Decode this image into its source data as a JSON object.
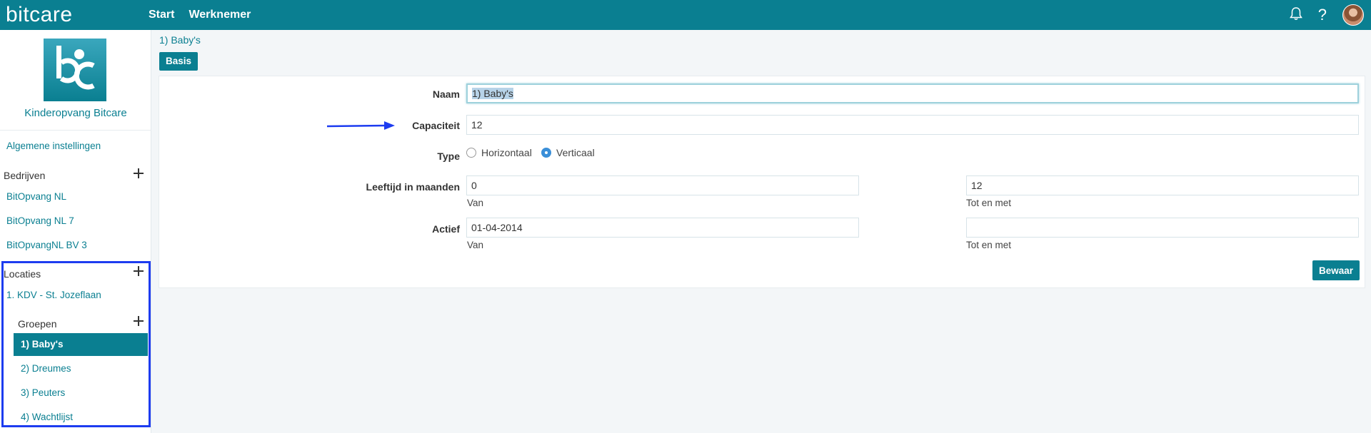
{
  "app": {
    "brand": "bitcare",
    "nav": [
      "Start",
      "Werknemer"
    ],
    "icons": [
      "bell-icon",
      "help-icon",
      "avatar"
    ]
  },
  "sidebar": {
    "org_name": "Kinderopvang Bitcare",
    "general_settings": "Algemene instellingen",
    "companies_heading": "Bedrijven",
    "companies": [
      "BitOpvang NL",
      "BitOpvang NL 7",
      "BitOpvangNL BV 3"
    ],
    "locations_heading": "Locaties",
    "location": "1. KDV - St. Jozeflaan",
    "groups_heading": "Groepen",
    "groups": [
      "1) Baby's",
      "2) Dreumes",
      "3) Peuters",
      "4) Wachtlijst"
    ],
    "active_group_index": 0
  },
  "main": {
    "breadcrumb": "1) Baby's",
    "tab": "Basis",
    "form": {
      "name_label": "Naam",
      "name_value": "1) Baby's",
      "capacity_label": "Capaciteit",
      "capacity_value": "12",
      "type_label": "Type",
      "type_options": [
        "Horizontaal",
        "Verticaal"
      ],
      "type_selected": "Verticaal",
      "age_label": "Leeftijd in maanden",
      "age_from": "0",
      "age_to": "12",
      "from_label": "Van",
      "to_label": "Tot en met",
      "active_label": "Actief",
      "active_from": "01-04-2014",
      "active_to": ""
    },
    "save_label": "Bewaar"
  },
  "colors": {
    "brand": "#0a7f91",
    "highlight": "#1d3cf0",
    "radio_checked": "#3b8fd8"
  }
}
